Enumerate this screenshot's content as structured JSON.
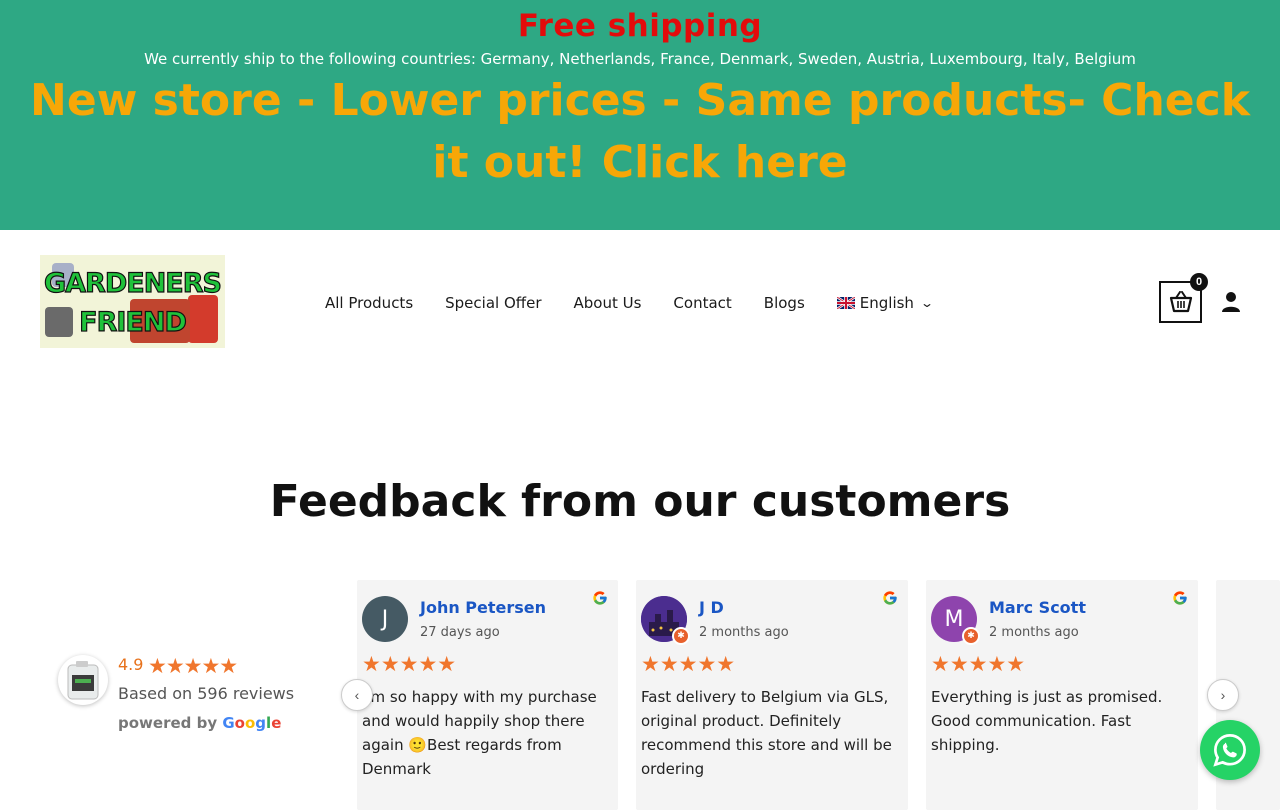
{
  "promo": {
    "title": "Free shipping",
    "subtitle": "We currently ship to the following countries: Germany, Netherlands, France, Denmark, Sweden, Austria, Luxembourg, Italy, Belgium",
    "cta": "New store - Lower prices - Same products- Check it out! Click here"
  },
  "logo": {
    "line1": "GARDENERS",
    "line2": "FRIEND"
  },
  "nav": {
    "items": [
      "All Products",
      "Special Offer",
      "About Us",
      "Contact",
      "Blogs"
    ],
    "language": "English"
  },
  "cart": {
    "count": "0"
  },
  "reviews": {
    "title": "Feedback from our customers",
    "summary": {
      "rating": "4.9",
      "stars": "★★★★★",
      "based_on": "Based on 596 reviews",
      "powered_by": "powered by",
      "google": [
        "G",
        "o",
        "o",
        "g",
        "l",
        "e"
      ]
    },
    "cards": [
      {
        "name": "John Petersen",
        "date": "27 days ago",
        "initial": "J",
        "stars": "★★★★★",
        "text": "I'm so happy with my purchase and would happily shop there again 🙂Best regards from Denmark"
      },
      {
        "name": "J D",
        "date": "2 months ago",
        "initial": "",
        "stars": "★★★★★",
        "text": "Fast delivery to Belgium via GLS, original product. Definitely recommend this store and will be ordering"
      },
      {
        "name": "Marc Scott",
        "date": "2 months ago",
        "initial": "M",
        "stars": "★★★★★",
        "text": "Everything is just as promised. Good communication. Fast shipping."
      }
    ]
  },
  "colors": {
    "banner": "#2ea884",
    "banner_title": "#e30b0b",
    "banner_cta": "#f7a707",
    "review_name": "#1a56c4",
    "star": "#f0762d",
    "whatsapp": "#25d366"
  },
  "icons": [
    "cart-icon",
    "user-icon",
    "chevron-down-icon",
    "google-icon",
    "whatsapp-icon",
    "arrow-left-icon",
    "arrow-right-icon"
  ]
}
